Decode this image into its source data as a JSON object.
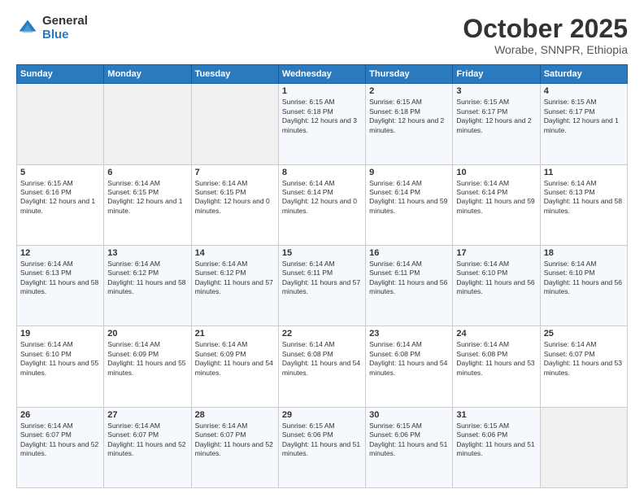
{
  "header": {
    "logo_general": "General",
    "logo_blue": "Blue",
    "title": "October 2025",
    "subtitle": "Worabe, SNNPR, Ethiopia"
  },
  "days_of_week": [
    "Sunday",
    "Monday",
    "Tuesday",
    "Wednesday",
    "Thursday",
    "Friday",
    "Saturday"
  ],
  "weeks": [
    [
      {
        "day": "",
        "info": ""
      },
      {
        "day": "",
        "info": ""
      },
      {
        "day": "",
        "info": ""
      },
      {
        "day": "1",
        "info": "Sunrise: 6:15 AM\nSunset: 6:18 PM\nDaylight: 12 hours and 3 minutes."
      },
      {
        "day": "2",
        "info": "Sunrise: 6:15 AM\nSunset: 6:18 PM\nDaylight: 12 hours and 2 minutes."
      },
      {
        "day": "3",
        "info": "Sunrise: 6:15 AM\nSunset: 6:17 PM\nDaylight: 12 hours and 2 minutes."
      },
      {
        "day": "4",
        "info": "Sunrise: 6:15 AM\nSunset: 6:17 PM\nDaylight: 12 hours and 1 minute."
      }
    ],
    [
      {
        "day": "5",
        "info": "Sunrise: 6:15 AM\nSunset: 6:16 PM\nDaylight: 12 hours and 1 minute."
      },
      {
        "day": "6",
        "info": "Sunrise: 6:14 AM\nSunset: 6:15 PM\nDaylight: 12 hours and 1 minute."
      },
      {
        "day": "7",
        "info": "Sunrise: 6:14 AM\nSunset: 6:15 PM\nDaylight: 12 hours and 0 minutes."
      },
      {
        "day": "8",
        "info": "Sunrise: 6:14 AM\nSunset: 6:14 PM\nDaylight: 12 hours and 0 minutes."
      },
      {
        "day": "9",
        "info": "Sunrise: 6:14 AM\nSunset: 6:14 PM\nDaylight: 11 hours and 59 minutes."
      },
      {
        "day": "10",
        "info": "Sunrise: 6:14 AM\nSunset: 6:14 PM\nDaylight: 11 hours and 59 minutes."
      },
      {
        "day": "11",
        "info": "Sunrise: 6:14 AM\nSunset: 6:13 PM\nDaylight: 11 hours and 58 minutes."
      }
    ],
    [
      {
        "day": "12",
        "info": "Sunrise: 6:14 AM\nSunset: 6:13 PM\nDaylight: 11 hours and 58 minutes."
      },
      {
        "day": "13",
        "info": "Sunrise: 6:14 AM\nSunset: 6:12 PM\nDaylight: 11 hours and 58 minutes."
      },
      {
        "day": "14",
        "info": "Sunrise: 6:14 AM\nSunset: 6:12 PM\nDaylight: 11 hours and 57 minutes."
      },
      {
        "day": "15",
        "info": "Sunrise: 6:14 AM\nSunset: 6:11 PM\nDaylight: 11 hours and 57 minutes."
      },
      {
        "day": "16",
        "info": "Sunrise: 6:14 AM\nSunset: 6:11 PM\nDaylight: 11 hours and 56 minutes."
      },
      {
        "day": "17",
        "info": "Sunrise: 6:14 AM\nSunset: 6:10 PM\nDaylight: 11 hours and 56 minutes."
      },
      {
        "day": "18",
        "info": "Sunrise: 6:14 AM\nSunset: 6:10 PM\nDaylight: 11 hours and 56 minutes."
      }
    ],
    [
      {
        "day": "19",
        "info": "Sunrise: 6:14 AM\nSunset: 6:10 PM\nDaylight: 11 hours and 55 minutes."
      },
      {
        "day": "20",
        "info": "Sunrise: 6:14 AM\nSunset: 6:09 PM\nDaylight: 11 hours and 55 minutes."
      },
      {
        "day": "21",
        "info": "Sunrise: 6:14 AM\nSunset: 6:09 PM\nDaylight: 11 hours and 54 minutes."
      },
      {
        "day": "22",
        "info": "Sunrise: 6:14 AM\nSunset: 6:08 PM\nDaylight: 11 hours and 54 minutes."
      },
      {
        "day": "23",
        "info": "Sunrise: 6:14 AM\nSunset: 6:08 PM\nDaylight: 11 hours and 54 minutes."
      },
      {
        "day": "24",
        "info": "Sunrise: 6:14 AM\nSunset: 6:08 PM\nDaylight: 11 hours and 53 minutes."
      },
      {
        "day": "25",
        "info": "Sunrise: 6:14 AM\nSunset: 6:07 PM\nDaylight: 11 hours and 53 minutes."
      }
    ],
    [
      {
        "day": "26",
        "info": "Sunrise: 6:14 AM\nSunset: 6:07 PM\nDaylight: 11 hours and 52 minutes."
      },
      {
        "day": "27",
        "info": "Sunrise: 6:14 AM\nSunset: 6:07 PM\nDaylight: 11 hours and 52 minutes."
      },
      {
        "day": "28",
        "info": "Sunrise: 6:14 AM\nSunset: 6:07 PM\nDaylight: 11 hours and 52 minutes."
      },
      {
        "day": "29",
        "info": "Sunrise: 6:15 AM\nSunset: 6:06 PM\nDaylight: 11 hours and 51 minutes."
      },
      {
        "day": "30",
        "info": "Sunrise: 6:15 AM\nSunset: 6:06 PM\nDaylight: 11 hours and 51 minutes."
      },
      {
        "day": "31",
        "info": "Sunrise: 6:15 AM\nSunset: 6:06 PM\nDaylight: 11 hours and 51 minutes."
      },
      {
        "day": "",
        "info": ""
      }
    ]
  ]
}
